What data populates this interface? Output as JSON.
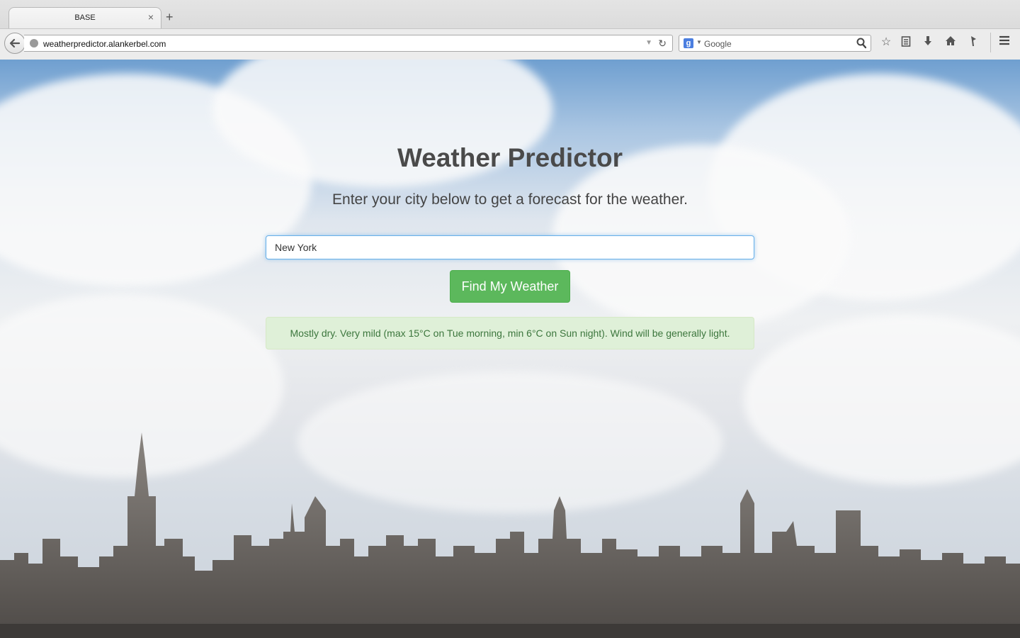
{
  "browser": {
    "tab_title": "BASE",
    "tab_close": "×",
    "new_tab": "+",
    "url": "weatherpredictor.alankerbel.com",
    "search_placeholder": "Google",
    "search_engine_glyph": "g"
  },
  "icons": {
    "back": "back-arrow-icon",
    "bookmark_star": "star-icon",
    "reading_list": "clipboard-icon",
    "downloads": "download-arrow-icon",
    "home": "home-icon",
    "pocket": "tag-icon",
    "menu": "hamburger-menu-icon"
  },
  "page": {
    "title": "Weather Predictor",
    "subtitle": "Enter your city below to get a forecast for the weather.",
    "city_value": "New York",
    "find_button": "Find My Weather",
    "forecast": "Mostly dry. Very mild (max 15°C on Tue morning, min 6°C on Sun night). Wind will be generally light."
  },
  "colors": {
    "button": "#5cb85c",
    "alert_bg": "#dff0d8",
    "alert_text": "#3c763d",
    "input_focus": "#66afe9"
  }
}
